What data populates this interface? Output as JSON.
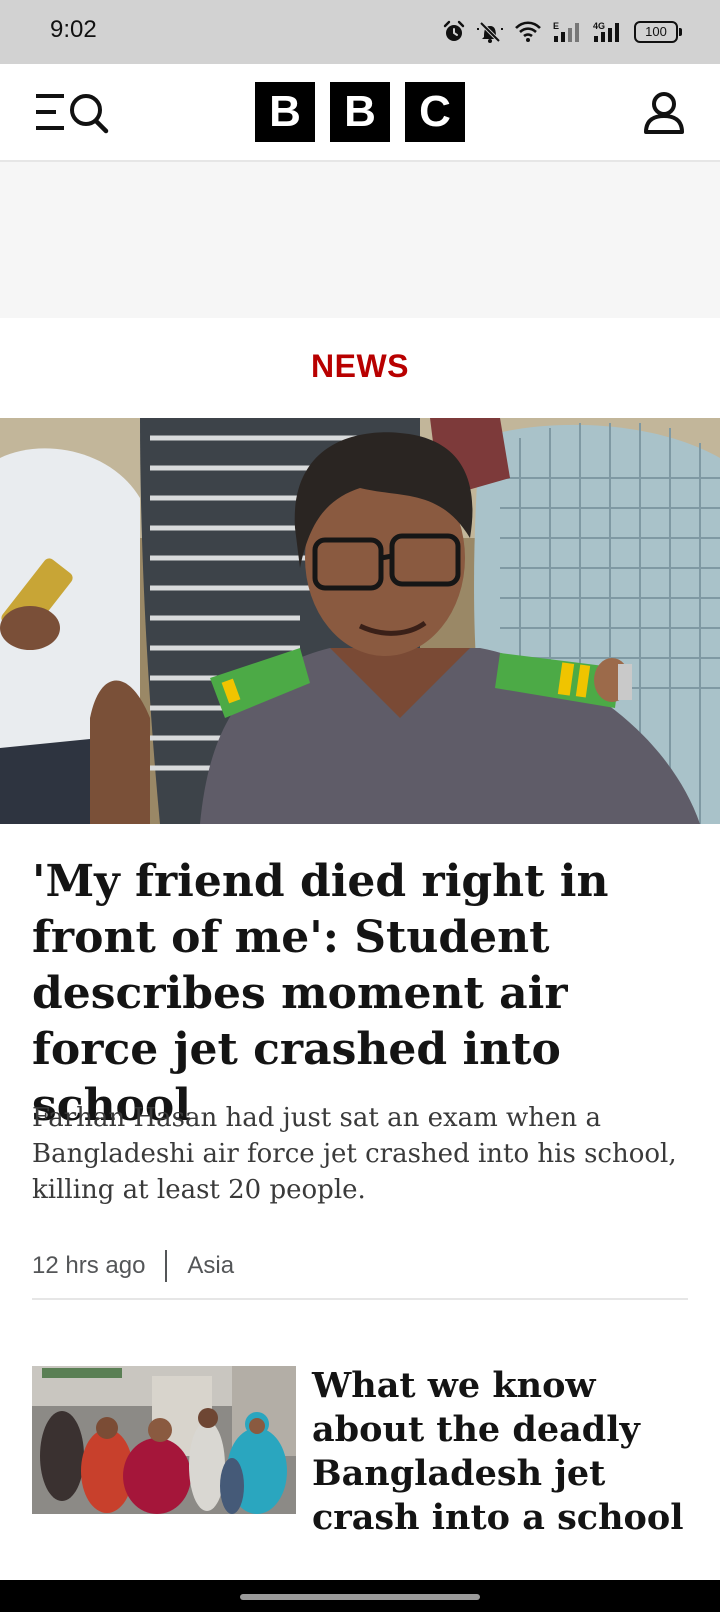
{
  "status_bar": {
    "time": "9:02",
    "battery": "100",
    "network": "4G",
    "icons": [
      "alarm-icon",
      "mute-icon",
      "wifi-icon",
      "signal-e-icon",
      "signal-4g-icon",
      "battery-icon"
    ]
  },
  "header": {
    "logo_letters": [
      "B",
      "B",
      "C"
    ],
    "menu_icon": "menu-search-icon",
    "account_icon": "account-icon"
  },
  "section": {
    "title": "NEWS"
  },
  "colors": {
    "accent": "#b80000",
    "status_bar_bg": "#d2d2d2"
  },
  "lead_story": {
    "headline": "'My friend died right in front of me': Student describes moment air force jet crashed into school",
    "summary": "Farhan Hasan had just sat an exam when a Bangladeshi air force jet crashed into his school, killing at least 20 people.",
    "time": "12 hrs ago",
    "topic": "Asia"
  },
  "second_story": {
    "headline": "What we know about the deadly Bangladesh jet crash into a school"
  }
}
